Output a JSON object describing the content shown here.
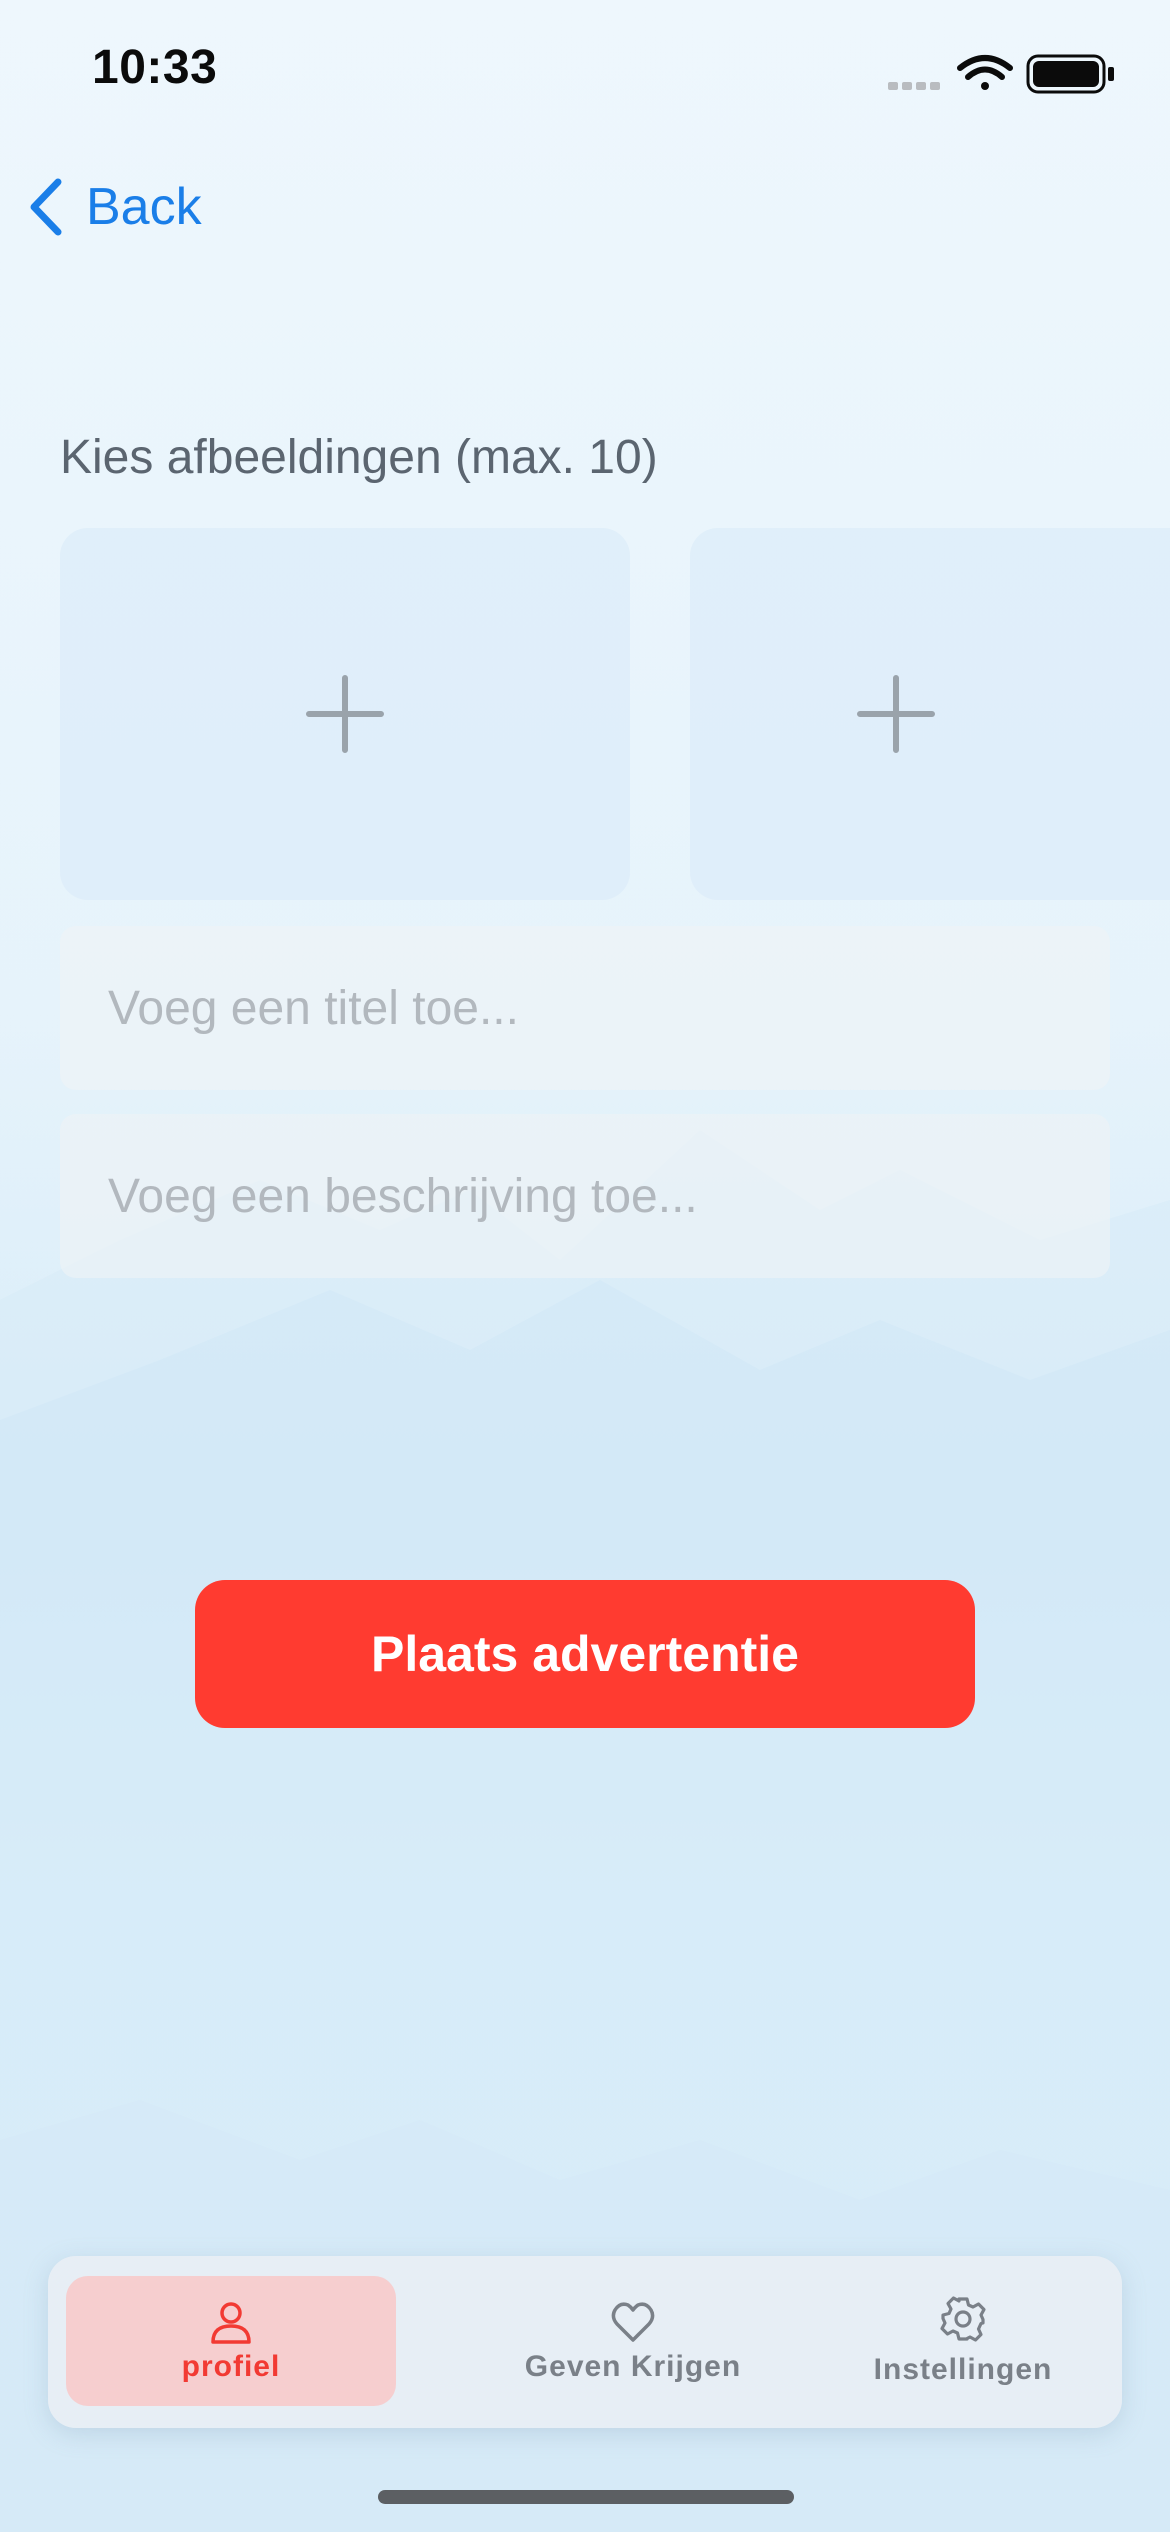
{
  "status_bar": {
    "time": "10:33"
  },
  "nav": {
    "back_label": "Back"
  },
  "images": {
    "label": "Kies afbeeldingen (max. 10)"
  },
  "form": {
    "title_placeholder": "Voeg een titel toe...",
    "description_placeholder": "Voeg een beschrijving toe..."
  },
  "actions": {
    "submit_label": "Plaats advertentie"
  },
  "tabbar": {
    "tabs": [
      {
        "label": "profiel",
        "icon": "person-icon",
        "active": true
      },
      {
        "label": "Geven Krijgen",
        "icon": "heart-icon",
        "active": false
      },
      {
        "label": "Instellingen",
        "icon": "gear-icon",
        "active": false
      }
    ]
  },
  "colors": {
    "accent": "#ff3b30",
    "link": "#1a7ee8",
    "inactive_tab": "#7a8088",
    "active_tab_bg": "#f8c8c8"
  }
}
